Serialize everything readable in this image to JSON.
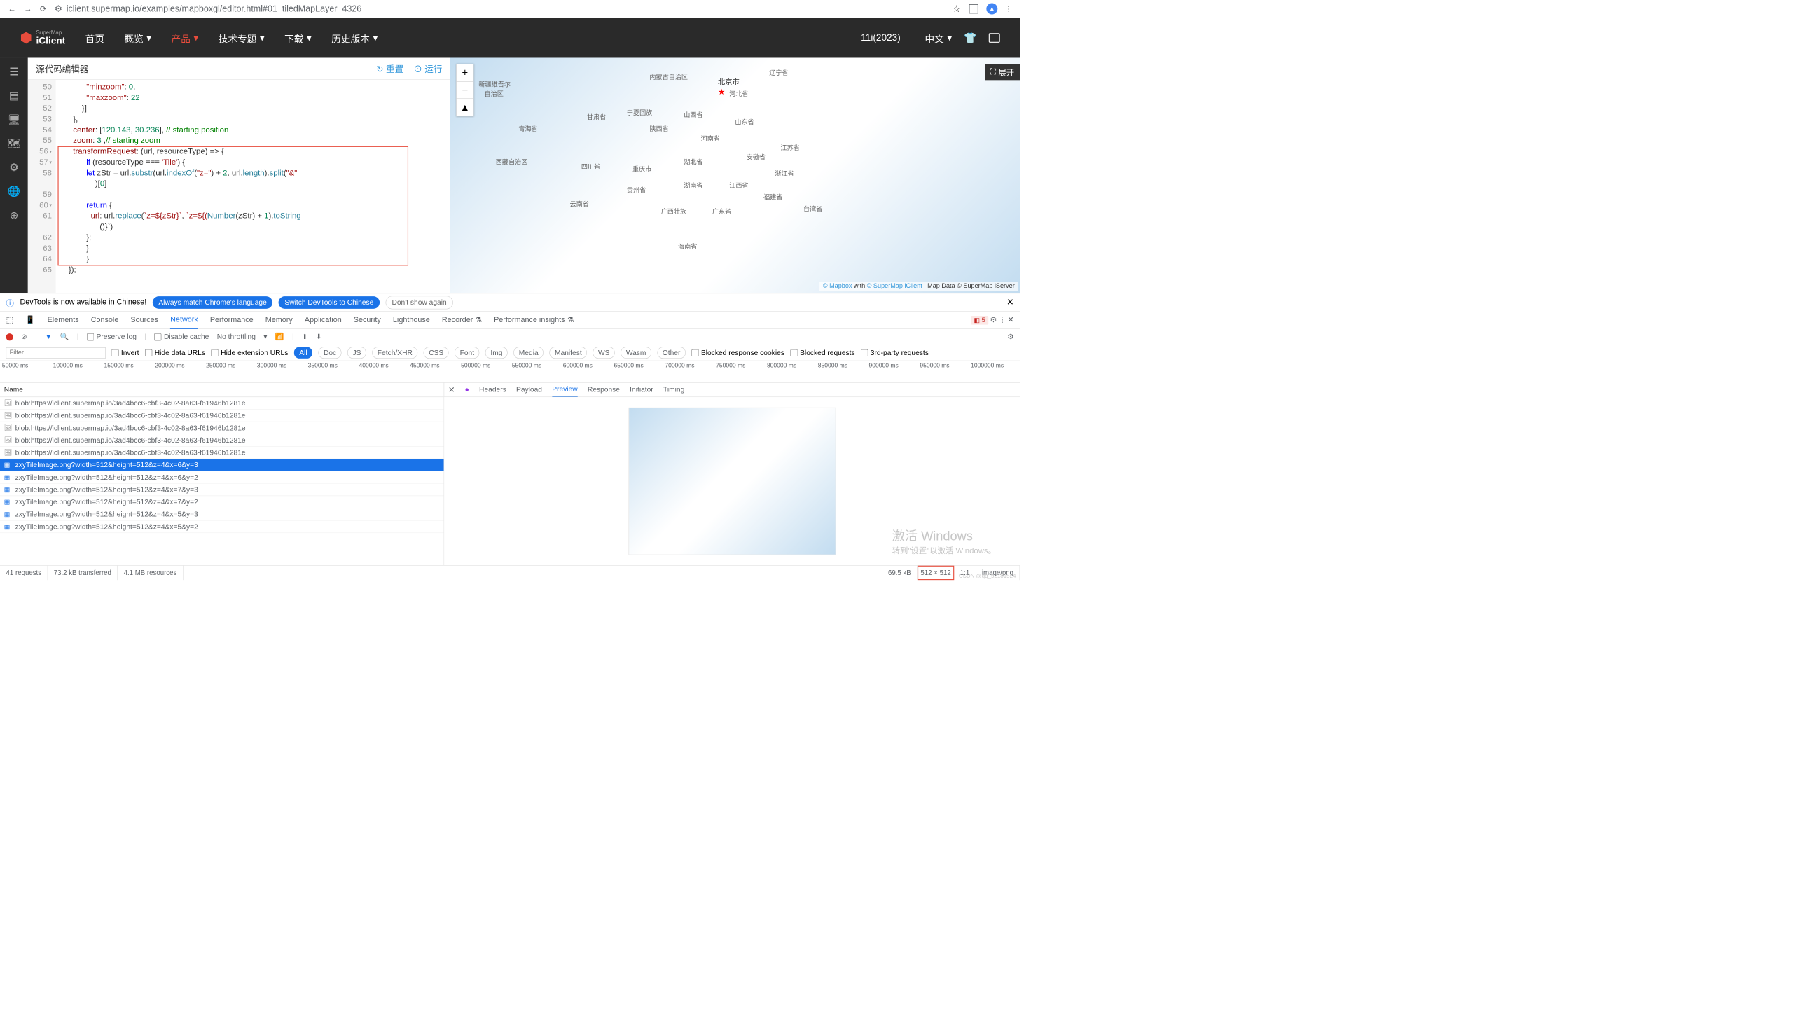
{
  "browser": {
    "url": "iclient.supermap.io/examples/mapboxgl/editor.html#01_tiledMapLayer_4326"
  },
  "nav": {
    "brand_super": "SuperMap",
    "brand_client": "iClient",
    "items": [
      "首页",
      "概览",
      "产品",
      "技术专题",
      "下载",
      "历史版本"
    ],
    "version": "11i(2023)",
    "lang": "中文"
  },
  "editor": {
    "title": "源代码编辑器",
    "reset": "重置",
    "run": "运行",
    "lines": {
      "50": {
        "indent": "            ",
        "p": "\"minzoom\"",
        "c": ": ",
        "n": "0",
        "e": ","
      },
      "51": {
        "indent": "            ",
        "p": "\"maxzoom\"",
        "c": ": ",
        "n": "22"
      },
      "52": {
        "indent": "          }]"
      },
      "53": {
        "indent": "      },"
      },
      "54": {
        "indent": "      ",
        "p": "center",
        "c": ": [",
        "n1": "120.143",
        "m": ", ",
        "n2": "30.236",
        "e": "], ",
        "cm": "// starting position"
      },
      "55": {
        "indent": "      ",
        "p": "zoom",
        "c": ": ",
        "n": "3",
        "e": " ,",
        "cm": "// starting zoom"
      },
      "56": {
        "indent": "      ",
        "p": "transformRequest",
        "c": ": (url, resourceType) => {"
      },
      "57": {
        "indent": "            ",
        "kw": "if",
        "c": " (resourceType === ",
        "s": "'Tile'",
        "e": ") {"
      },
      "58": {
        "indent": "            ",
        "kw": "let",
        "v": " zStr = url.",
        "f1": "substr",
        "c1": "(url.",
        "f2": "indexOf",
        "c2": "(",
        "s": "\"z=\"",
        "c3": ") + ",
        "n": "2",
        "c4": ", url.",
        "f3": "length",
        "c5": ").",
        "f4": "split",
        "c6": "(",
        "s2": "\"&\""
      },
      "58b": {
        "indent": "                )[",
        "n": "0",
        "e": "]"
      },
      "59": {
        "indent": ""
      },
      "60": {
        "indent": "            ",
        "kw": "return",
        "e": " {"
      },
      "61": {
        "indent": "              ",
        "p": "url",
        "c": ": url.",
        "f": "replace",
        "c1": "(",
        "t1": "`z=${zStr}`",
        "c2": ", ",
        "t2": "`z=${(",
        "fn": "Number",
        "c3": "(zStr) + ",
        "n": "1",
        "c4": ").",
        "f2": "toString"
      },
      "61b": {
        "indent": "                  ()}`",
        ")": ""
      },
      "62": {
        "indent": "            };"
      },
      "63": {
        "indent": "            }"
      },
      "64": {
        "indent": "            }"
      },
      "65": {
        "indent": "    });"
      }
    }
  },
  "map": {
    "expand": "展开",
    "attr_mapbox": "© Mapbox",
    "attr_with": " with ",
    "attr_iclient": "© SuperMap iClient",
    "attr_sep": " | ",
    "attr_mapdata": "Map Data",
    "attr_iserver": " © SuperMap iServer",
    "beijing": "北京市",
    "labels": [
      {
        "t": "新疆维吾尔",
        "l": 5,
        "tp": 9
      },
      {
        "t": "自治区",
        "l": 6,
        "tp": 13
      },
      {
        "t": "内蒙古自治区",
        "l": 35,
        "tp": 6
      },
      {
        "t": "辽宁省",
        "l": 56,
        "tp": 4
      },
      {
        "t": "河北省",
        "l": 49,
        "tp": 13
      },
      {
        "t": "山西省",
        "l": 41,
        "tp": 22
      },
      {
        "t": "陕西省",
        "l": 35,
        "tp": 28
      },
      {
        "t": "青海省",
        "l": 12,
        "tp": 28
      },
      {
        "t": "西藏自治区",
        "l": 8,
        "tp": 42
      },
      {
        "t": "四川省",
        "l": 23,
        "tp": 44
      },
      {
        "t": "重庆市",
        "l": 32,
        "tp": 45
      },
      {
        "t": "湖北省",
        "l": 41,
        "tp": 42
      },
      {
        "t": "安徽省",
        "l": 52,
        "tp": 40
      },
      {
        "t": "江苏省",
        "l": 58,
        "tp": 36
      },
      {
        "t": "湖南省",
        "l": 41,
        "tp": 52
      },
      {
        "t": "贵州省",
        "l": 31,
        "tp": 54
      },
      {
        "t": "云南省",
        "l": 21,
        "tp": 60
      },
      {
        "t": "广西壮族",
        "l": 37,
        "tp": 63
      },
      {
        "t": "广东省",
        "l": 46,
        "tp": 63
      },
      {
        "t": "江西省",
        "l": 49,
        "tp": 52
      },
      {
        "t": "浙江省",
        "l": 57,
        "tp": 47
      },
      {
        "t": "福建省",
        "l": 55,
        "tp": 57
      },
      {
        "t": "台湾省",
        "l": 62,
        "tp": 62
      },
      {
        "t": "海南省",
        "l": 40,
        "tp": 78
      },
      {
        "t": "河南省",
        "l": 44,
        "tp": 32
      },
      {
        "t": "山东省",
        "l": 50,
        "tp": 25
      },
      {
        "t": "甘肃省",
        "l": 24,
        "tp": 23
      },
      {
        "t": "宁夏回族",
        "l": 31,
        "tp": 21
      }
    ]
  },
  "devtools": {
    "banner_text": "DevTools is now available in Chinese!",
    "banner_btn1": "Always match Chrome's language",
    "banner_btn2": "Switch DevTools to Chinese",
    "banner_btn3": "Don't show again",
    "tabs": [
      "Elements",
      "Console",
      "Sources",
      "Network",
      "Performance",
      "Memory",
      "Application",
      "Security",
      "Lighthouse",
      "Recorder",
      "Performance insights"
    ],
    "badge_count": "5",
    "toolbar": {
      "preserve": "Preserve log",
      "disable_cache": "Disable cache",
      "throttling": "No throttling"
    },
    "filter": {
      "placeholder": "Filter",
      "invert": "Invert",
      "hide_data": "Hide data URLs",
      "hide_ext": "Hide extension URLs",
      "chips": [
        "All",
        "Doc",
        "JS",
        "Fetch/XHR",
        "CSS",
        "Font",
        "Img",
        "Media",
        "Manifest",
        "WS",
        "Wasm",
        "Other"
      ],
      "blocked_cookies": "Blocked response cookies",
      "blocked_req": "Blocked requests",
      "third_party": "3rd-party requests"
    },
    "timeline": [
      "50000 ms",
      "100000 ms",
      "150000 ms",
      "200000 ms",
      "250000 ms",
      "300000 ms",
      "350000 ms",
      "400000 ms",
      "450000 ms",
      "500000 ms",
      "550000 ms",
      "600000 ms",
      "650000 ms",
      "700000 ms",
      "750000 ms",
      "800000 ms",
      "850000 ms",
      "900000 ms",
      "950000 ms",
      "1000000 ms"
    ],
    "name_header": "Name",
    "rows": [
      {
        "icon": "img",
        "text": "blob:https://iclient.supermap.io/3ad4bcc6-cbf3-4c02-8a63-f61946b1281e",
        "sel": false
      },
      {
        "icon": "img",
        "text": "blob:https://iclient.supermap.io/3ad4bcc6-cbf3-4c02-8a63-f61946b1281e",
        "sel": false
      },
      {
        "icon": "img",
        "text": "blob:https://iclient.supermap.io/3ad4bcc6-cbf3-4c02-8a63-f61946b1281e",
        "sel": false
      },
      {
        "icon": "img",
        "text": "blob:https://iclient.supermap.io/3ad4bcc6-cbf3-4c02-8a63-f61946b1281e",
        "sel": false
      },
      {
        "icon": "img",
        "text": "blob:https://iclient.supermap.io/3ad4bcc6-cbf3-4c02-8a63-f61946b1281e",
        "sel": false
      },
      {
        "icon": "tile",
        "text": "zxyTileImage.png?width=512&height=512&z=4&x=6&y=3",
        "sel": true
      },
      {
        "icon": "tile",
        "text": "zxyTileImage.png?width=512&height=512&z=4&x=6&y=2",
        "sel": false
      },
      {
        "icon": "tile",
        "text": "zxyTileImage.png?width=512&height=512&z=4&x=7&y=3",
        "sel": false
      },
      {
        "icon": "tile",
        "text": "zxyTileImage.png?width=512&height=512&z=4&x=7&y=2",
        "sel": false
      },
      {
        "icon": "tile",
        "text": "zxyTileImage.png?width=512&height=512&z=4&x=5&y=3",
        "sel": false
      },
      {
        "icon": "tile",
        "text": "zxyTileImage.png?width=512&height=512&z=4&x=5&y=2",
        "sel": false
      }
    ],
    "detail_tabs": [
      "Headers",
      "Payload",
      "Preview",
      "Response",
      "Initiator",
      "Timing"
    ],
    "status": {
      "requests": "41 requests",
      "transferred": "73.2 kB transferred",
      "resources": "4.1 MB resources",
      "size": "69.5 kB",
      "dims": "512 × 512",
      "ratio": "1:1",
      "type": "image/png"
    }
  },
  "watermark": {
    "line1": "激活 Windows",
    "line2": "转到\"设置\"以激活 Windows。"
  },
  "csdn": "CSDN @qq_52181524"
}
